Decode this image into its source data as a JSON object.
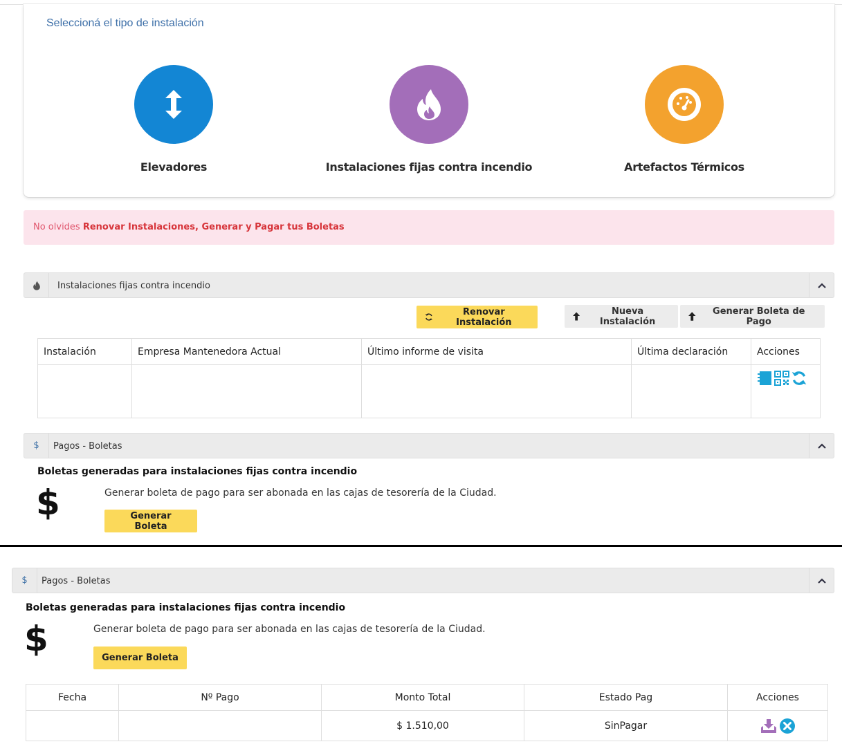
{
  "selection": {
    "title": "Seleccioná el tipo de instalación",
    "options": [
      {
        "label": "Elevadores",
        "color": "#1386d4",
        "icon": "arrows-updown-icon"
      },
      {
        "label": "Instalaciones fijas contra incendio",
        "color": "#a36eb9",
        "icon": "fire-icon"
      },
      {
        "label": "Artefactos Térmicos",
        "color": "#f3a22e",
        "icon": "gauge-icon"
      }
    ]
  },
  "alert": {
    "prefix": "No olvides ",
    "emphasis": "Renovar Instalaciones, Generar y Pagar tus Boletas"
  },
  "fire_panel": {
    "title": "Instalaciones fijas contra incendio",
    "buttons": {
      "renew": "Renovar Instalación",
      "new": "Nueva Instalación",
      "generate": "Generar Boleta de Pago"
    },
    "table": {
      "headers": [
        "Instalación",
        "Empresa Mantenedora Actual",
        "Último informe de visita",
        "Última declaración",
        "Acciones"
      ]
    }
  },
  "payments_panel_1": {
    "title": "Pagos - Boletas",
    "subtitle": "Boletas generadas para instalaciones fijas contra incendio",
    "description": "Generar boleta de pago para ser abonada en las cajas de tesorería de la Ciudad.",
    "button": "Generar Boleta",
    "symbol": "$"
  },
  "payments_panel_2": {
    "title": "Pagos - Boletas",
    "subtitle": "Boletas generadas para instalaciones fijas contra incendio",
    "description": "Generar boleta de pago para ser abonada en las cajas de tesorería de la Ciudad.",
    "button": "Generar Boleta",
    "symbol": "$",
    "table": {
      "headers": [
        "Fecha",
        "Nº Pago",
        "Monto Total",
        "Estado Pag",
        "Acciones"
      ],
      "rows": [
        {
          "fecha": "",
          "pago": "",
          "monto": "$ 1.510,00",
          "estado": "SinPagar"
        }
      ]
    }
  }
}
